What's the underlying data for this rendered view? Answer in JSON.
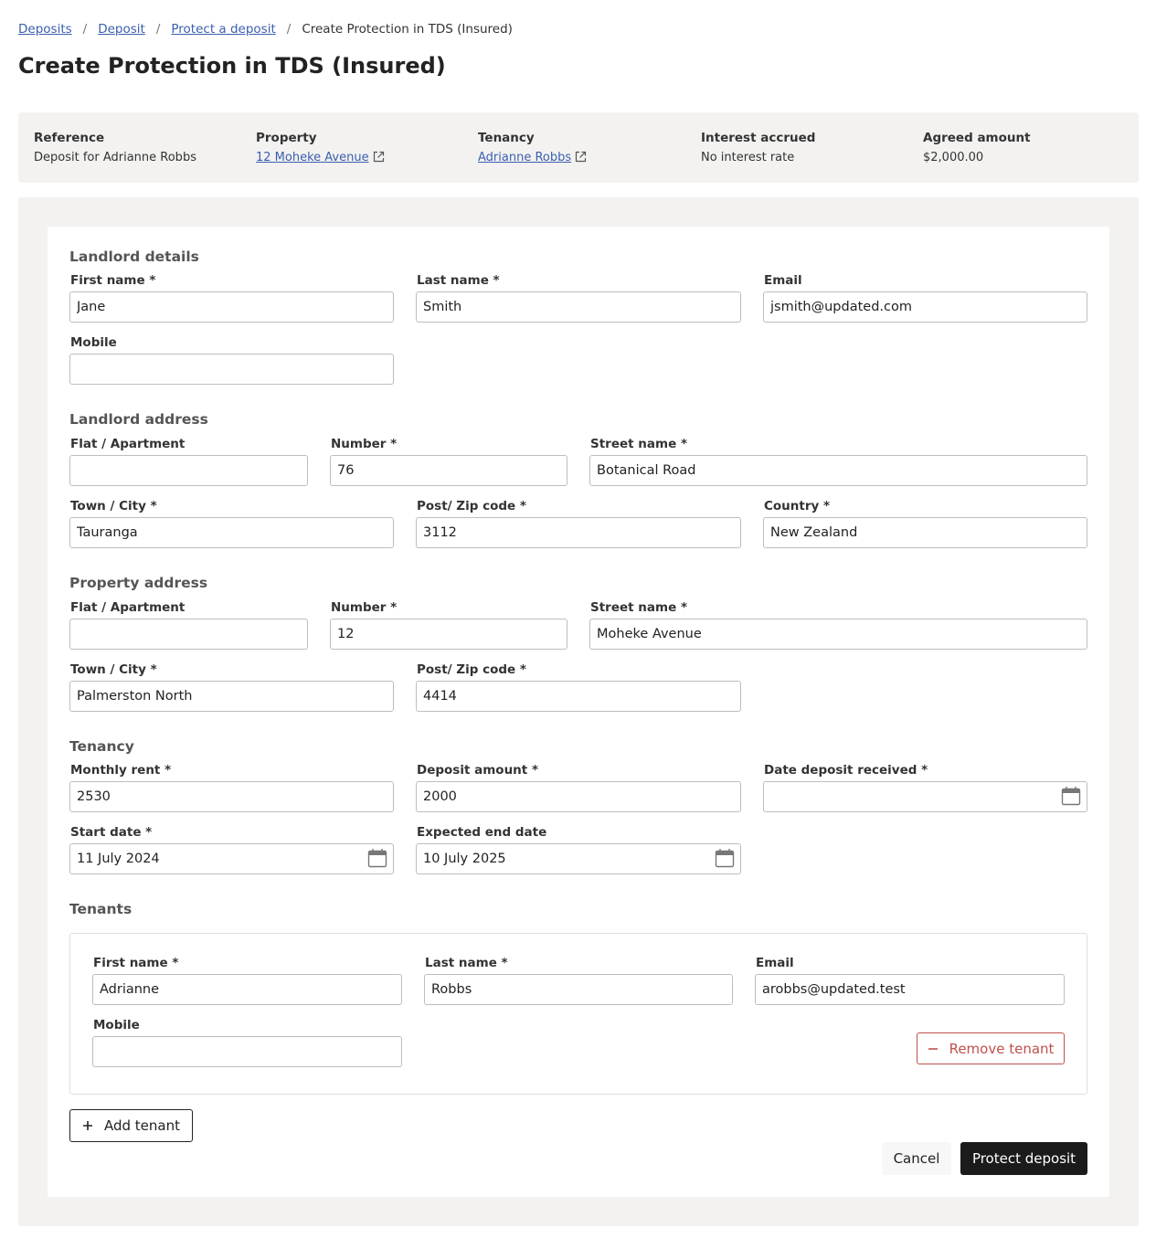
{
  "breadcrumb": {
    "items": [
      "Deposits",
      "Deposit",
      "Protect a deposit"
    ],
    "separator": "/",
    "current": "Create Protection in TDS (Insured)"
  },
  "page_title": "Create Protection in TDS (Insured)",
  "summary": {
    "reference_label": "Reference",
    "reference_value": "Deposit for Adrianne Robbs",
    "property_label": "Property",
    "property_value": "12 Moheke Avenue",
    "tenancy_label": "Tenancy",
    "tenancy_value": "Adrianne Robbs",
    "interest_label": "Interest accrued",
    "interest_value": "No interest rate",
    "agreed_label": "Agreed amount",
    "agreed_value": "$2,000.00"
  },
  "landlord_details": {
    "title": "Landlord details",
    "first_name_label": "First name *",
    "first_name": "Jane",
    "last_name_label": "Last name *",
    "last_name": "Smith",
    "email_label": "Email",
    "email": "jsmith@updated.com",
    "mobile_label": "Mobile",
    "mobile": ""
  },
  "landlord_address": {
    "title": "Landlord address",
    "flat_label": "Flat / Apartment",
    "flat": "",
    "number_label": "Number *",
    "number": "76",
    "street_label": "Street name *",
    "street": "Botanical Road",
    "town_label": "Town / City *",
    "town": "Tauranga",
    "post_label": "Post/ Zip code *",
    "post": "3112",
    "country_label": "Country *",
    "country": "New Zealand"
  },
  "property_address": {
    "title": "Property address",
    "flat_label": "Flat / Apartment",
    "flat": "",
    "number_label": "Number *",
    "number": "12",
    "street_label": "Street name *",
    "street": "Moheke Avenue",
    "town_label": "Town / City *",
    "town": "Palmerston North",
    "post_label": "Post/ Zip code *",
    "post": "4414"
  },
  "tenancy": {
    "title": "Tenancy",
    "rent_label": "Monthly rent *",
    "rent": "2530",
    "deposit_label": "Deposit amount *",
    "deposit": "2000",
    "received_label": "Date deposit received *",
    "received": "",
    "start_label": "Start date *",
    "start": "11 July 2024",
    "end_label": "Expected end date",
    "end": "10 July 2025"
  },
  "tenants": {
    "title": "Tenants",
    "first_name_label": "First name *",
    "first_name": "Adrianne",
    "last_name_label": "Last name *",
    "last_name": "Robbs",
    "email_label": "Email",
    "email": "arobbs@updated.test",
    "mobile_label": "Mobile",
    "mobile": "",
    "remove_label": "Remove tenant",
    "add_label": "Add tenant"
  },
  "actions": {
    "cancel_label": "Cancel",
    "protect_label": "Protect deposit"
  },
  "icons": {
    "external_link": "external-link-icon",
    "calendar": "calendar-icon",
    "minus": "minus-icon",
    "plus": "plus-icon"
  },
  "colors": {
    "link": "#3a5fae",
    "danger": "#c0504d",
    "primary_button": "#1b1b1b",
    "panel_background": "#f3f2f1"
  }
}
